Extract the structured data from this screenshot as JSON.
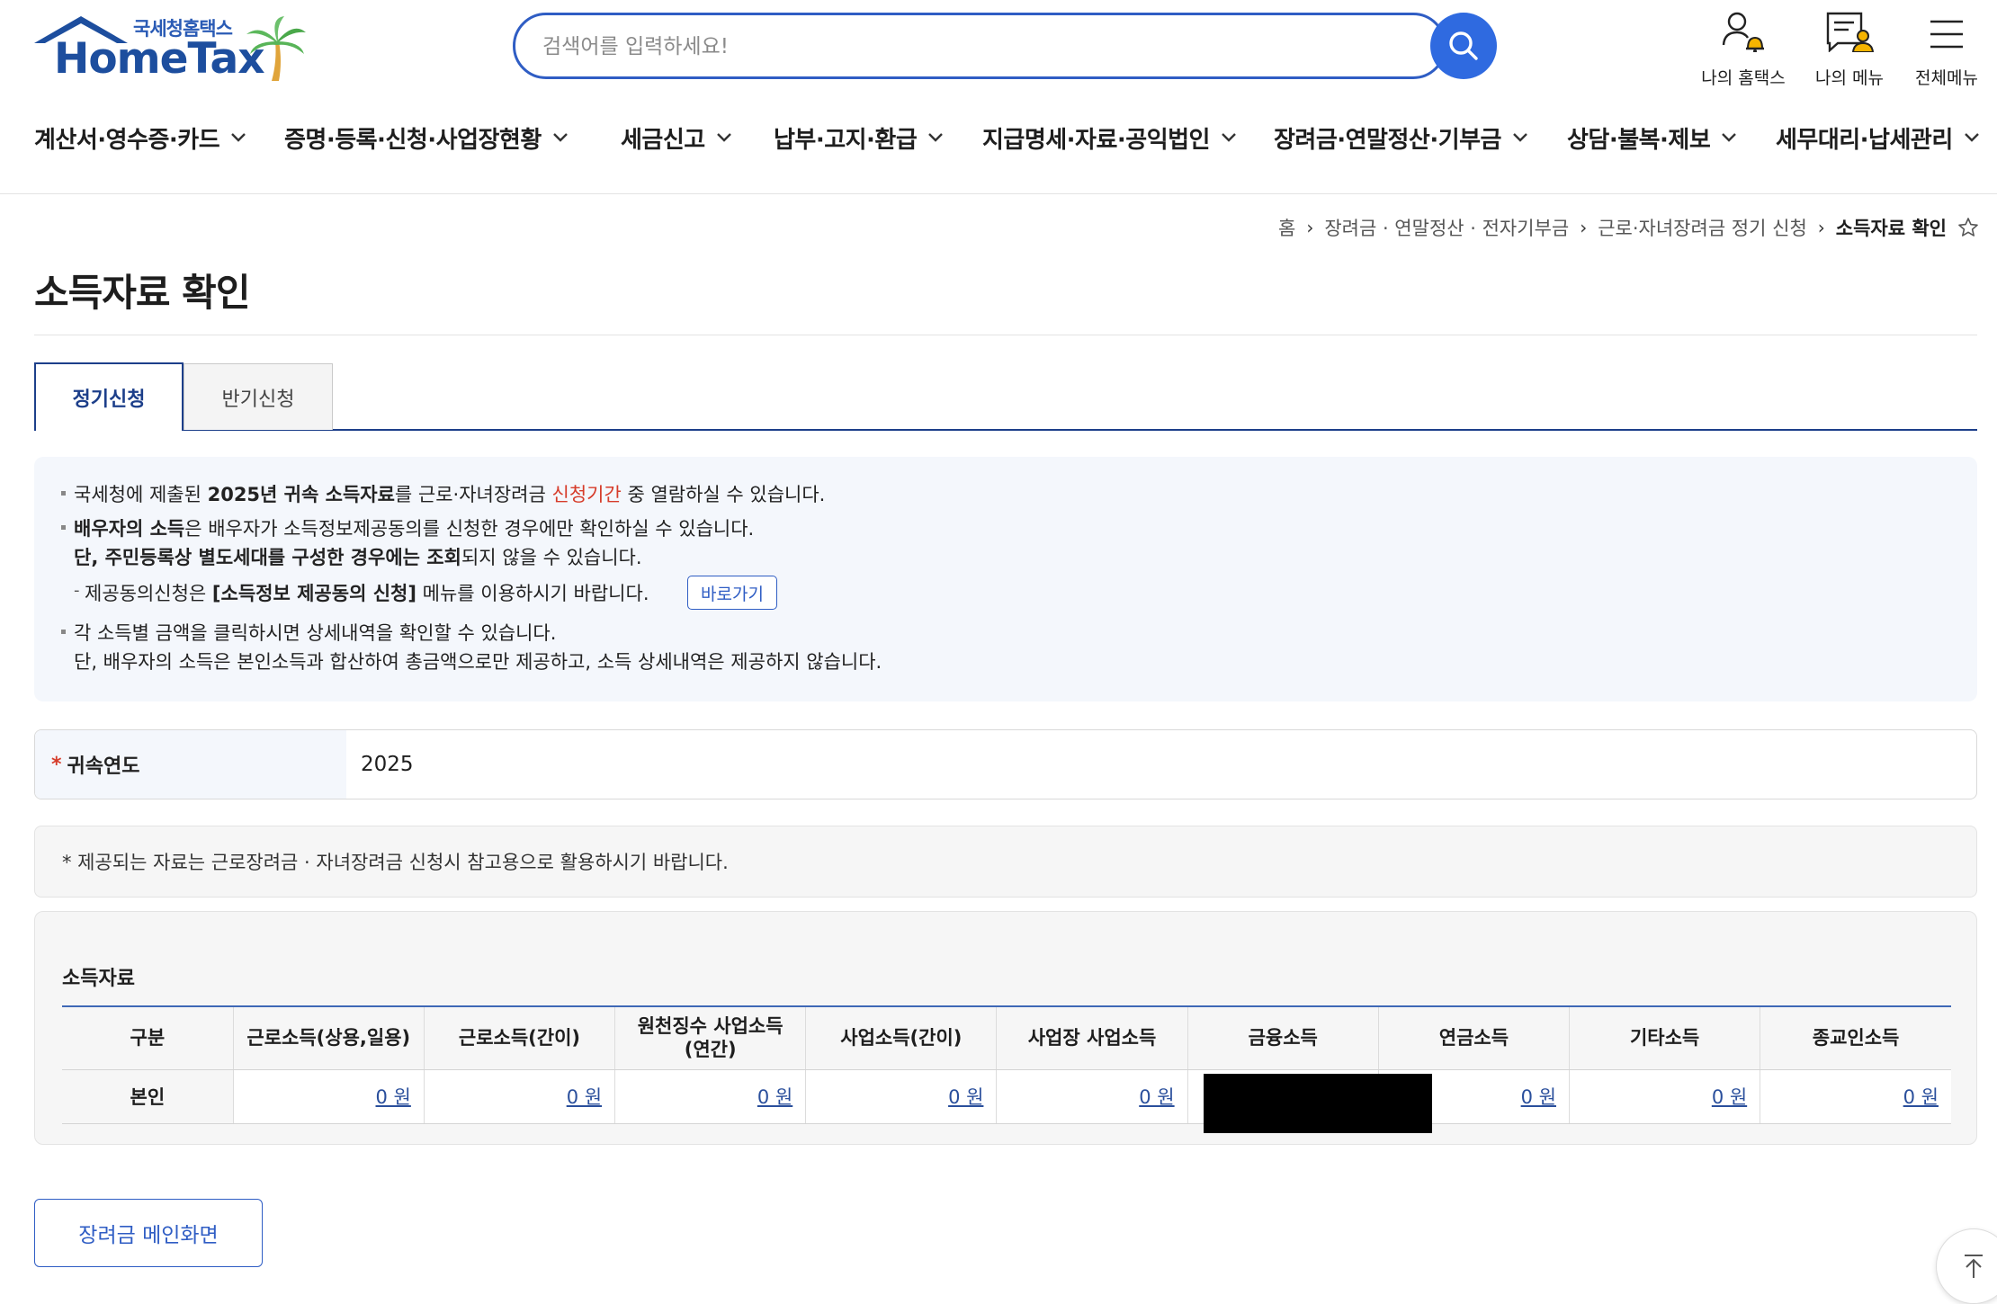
{
  "header": {
    "logo_sub": "국세청홈택스",
    "logo_main": "HomeTax",
    "search_placeholder": "검색어를 입력하세요!",
    "util": [
      {
        "label": "나의 홈택스",
        "icon": "user-bell-icon"
      },
      {
        "label": "나의 메뉴",
        "icon": "menu-list-icon"
      },
      {
        "label": "전체메뉴",
        "icon": "hamburger-icon"
      }
    ]
  },
  "gnb": [
    "계산서·영수증·카드",
    "증명·등록·신청·사업장현황",
    "세금신고",
    "납부·고지·환급",
    "지급명세·자료·공익법인",
    "장려금·연말정산·기부금",
    "상담·불복·제보",
    "세무대리·납세관리"
  ],
  "breadcrumb": {
    "home": "홈",
    "level1": "장려금 · 연말정산 · 전자기부금",
    "level2": "근로·자녀장려금 정기 신청",
    "current": "소득자료 확인"
  },
  "page_title": "소득자료 확인",
  "tabs": [
    {
      "label": "정기신청",
      "active": true
    },
    {
      "label": "반기신청",
      "active": false
    }
  ],
  "notice": {
    "l1_a": "국세청에 제출된 ",
    "l1_b": "2025년 귀속 소득자료",
    "l1_c": "를 근로·자녀장려금 ",
    "l1_d": "신청기간",
    "l1_e": " 중 열람하실 수 있습니다.",
    "l2_a": "배우자의 소득",
    "l2_b": "은 배우자가 소득정보제공동의를 신청한 경우에만 확인하실 수 있습니다.",
    "l3_a": "단, 주민등록상 별도세대를 구성한 경우에는 조회",
    "l3_b": "되지 않을 수 있습니다.",
    "l4_a": "제공동의신청은 ",
    "l4_b": "[소득정보 제공동의 신청]",
    "l4_c": " 메뉴를 이용하시기 바랍니다.",
    "goto_label": "바로가기",
    "l5": "각 소득별 금액을 클릭하시면 상세내역을 확인할 수 있습니다.",
    "l6": "단, 배우자의 소득은 본인소득과 합산하여 총금액으로만 제공하고, 소득 상세내역은 제공하지 않습니다."
  },
  "year_field": {
    "required_mark": "*",
    "label": "귀속연도",
    "value": "2025"
  },
  "info_note": "* 제공되는 자료는 근로장려금 · 자녀장려금 신청시 참고용으로 활용하시기 바랍니다.",
  "income_table": {
    "title": "소득자료",
    "headers": [
      "구분",
      "근로소득(상용,일용)",
      "근로소득(간이)",
      "원천징수 사업소득\n(연간)",
      "사업소득(간이)",
      "사업장 사업소득",
      "금융소득",
      "연금소득",
      "기타소득",
      "종교인소득"
    ],
    "rows": [
      {
        "label": "본인",
        "cells": [
          "0 원",
          "0 원",
          "0 원",
          "0 원",
          "0 원",
          "",
          "0 원",
          "0 원",
          "0 원"
        ]
      }
    ]
  },
  "main_button": "장려금 메인화면",
  "colors": {
    "brand_blue": "#2f5dc4",
    "tab_navy": "#1d3f8a",
    "accent_red": "#d63c2a",
    "link_blue": "#2a4f9c"
  }
}
